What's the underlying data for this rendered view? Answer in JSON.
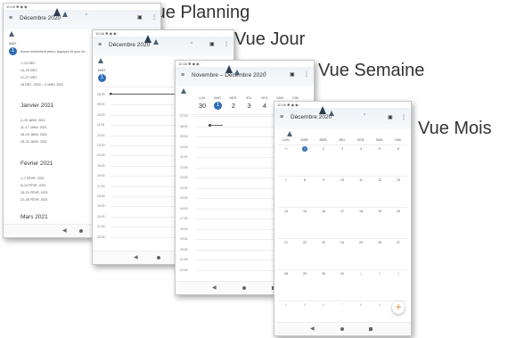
{
  "captions": {
    "planning": "Vue Planning",
    "jour": "Vue Jour",
    "semaine": "Vue Semaine",
    "mois": "Vue Mois"
  },
  "planning": {
    "status": "10:46 ✱ ◉ ◉ ·",
    "title": "Décembre 2020",
    "today_label": "MAR.",
    "today_num": "1",
    "first_event": "Aucun événement prévu. Appuyez ici pour en...",
    "dec_weeks": [
      "7–13 DÉC.",
      "14–20 DÉC.",
      "21–27 DÉC.",
      "28 DÉC. 2020 – 3 JANV. 2021"
    ],
    "jan_heading": "Janvier 2021",
    "jan_weeks": [
      "4–10 JANV. 2021",
      "11–17 JANV. 2021",
      "18–24 JANV. 2021",
      "25–31 JANV. 2021"
    ],
    "feb_heading": "Février 2021",
    "feb_weeks": [
      "1–7 FÉVR. 2021",
      "8–14 FÉVR. 2021",
      "15–21 FÉVR. 2021",
      "22–28 FÉVR. 2021"
    ],
    "mar_heading": "Mars 2021"
  },
  "jour": {
    "status": "10:46 ✱ ◉ ◉ ·",
    "title": "Décembre 2020",
    "today_label": "MAR.",
    "today_num": "1",
    "hours": [
      "08:00",
      "09:00",
      "10:00",
      "11:00",
      "12:00",
      "13:00",
      "14:00",
      "15:00",
      "16:00",
      "17:00",
      "18:00",
      "19:00",
      "20:00",
      "21:00",
      "22:00"
    ]
  },
  "semaine": {
    "status": "10:46 ✱ ◉ ◉ ·",
    "title": "Novembre – Décembre 2020",
    "days": [
      {
        "dow": "LUN.",
        "num": "30"
      },
      {
        "dow": "MAR.",
        "num": "1"
      },
      {
        "dow": "MER.",
        "num": "2"
      },
      {
        "dow": "JEU.",
        "num": "3"
      },
      {
        "dow": "VEN.",
        "num": "4"
      },
      {
        "dow": "SAM.",
        "num": "5"
      },
      {
        "dow": "DIM.",
        "num": "6"
      }
    ],
    "hours": [
      "07:00",
      "08:00",
      "09:00",
      "10:00",
      "11:00",
      "12:00",
      "13:00",
      "14:00",
      "15:00",
      "16:00",
      "17:00",
      "18:00",
      "19:00",
      "20:00",
      "21:00",
      "22:00"
    ]
  },
  "mois": {
    "status": "10:46 ✱ ◉ ◉ ·",
    "title": "Décembre 2020",
    "dows": [
      "LUN.",
      "MAR.",
      "MER.",
      "JEU.",
      "VEN.",
      "SAM.",
      "DIM."
    ],
    "weeks": [
      [
        "30",
        "1",
        "2",
        "3",
        "4",
        "5",
        "6"
      ],
      [
        "7",
        "8",
        "9",
        "10",
        "11",
        "12",
        "13"
      ],
      [
        "14",
        "15",
        "16",
        "17",
        "18",
        "19",
        "20"
      ],
      [
        "21",
        "22",
        "23",
        "24",
        "25",
        "26",
        "27"
      ],
      [
        "28",
        "29",
        "30",
        "31",
        "1",
        "2",
        "3"
      ],
      [
        "4",
        "5",
        "6",
        "7",
        "8",
        "9",
        "10"
      ]
    ],
    "fab": "+"
  },
  "nav": {
    "back": "◀"
  },
  "icons": {
    "menu": "≡",
    "calendar": "▣",
    "more": "⋮"
  }
}
